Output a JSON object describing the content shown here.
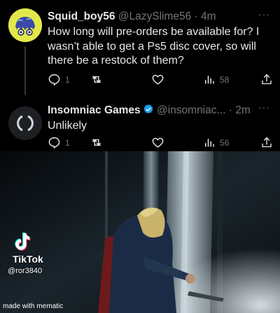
{
  "tweets": [
    {
      "display_name": "Squid_boy56",
      "handle": "@LazySlime56",
      "time": "· 4m",
      "more": "···",
      "text": "How long will pre-orders be available for? I wasn’t able to get a Ps5 disc cover, so will there be a restock of them?",
      "reply_count": "1",
      "retweet_count": "",
      "like_count": "",
      "views": "58",
      "avatar_bg": "#e3e84a"
    },
    {
      "display_name": "Insomniac Games",
      "handle": "@insomniac...",
      "time": "· 2m",
      "more": "···",
      "text": "Unlikely",
      "reply_count": "1",
      "retweet_count": "",
      "like_count": "",
      "views": "56",
      "verified": true,
      "avatar_bg": "#1d1f23"
    }
  ],
  "colors": {
    "background": "#000000",
    "text": "#e7e9ea",
    "secondary": "#71767b",
    "verified": "#1d9bf0"
  },
  "icons": [
    "reply-icon",
    "retweet-icon",
    "like-icon",
    "views-icon",
    "share-icon",
    "verified-badge-icon",
    "tiktok-logo-icon"
  ],
  "video": {
    "watermark_brand": "TikTok",
    "watermark_handle": "@ror3840",
    "caption_credit": "made with mematic"
  }
}
